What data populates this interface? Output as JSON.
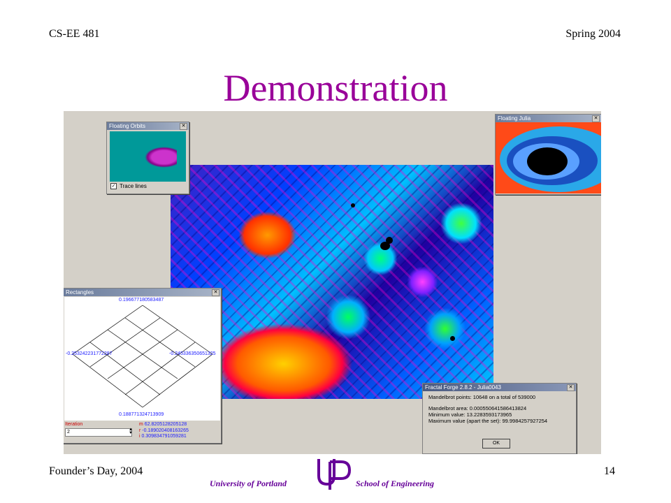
{
  "header": {
    "course": "CS-EE 481",
    "term": "Spring 2004"
  },
  "slide": {
    "title": "Demonstration"
  },
  "floating_orbits": {
    "title": "Floating Orbits",
    "trace_lines_label": "Trace lines",
    "trace_lines_checked": true
  },
  "floating_julia": {
    "title": "Floating Julia"
  },
  "rectangles": {
    "title": "Rectangles",
    "top": "0.196677180583487",
    "left": "-0.253242231772287",
    "right": "-0.245336350651325",
    "bottom": "0.188771324713909",
    "iteration_label": "Iteration",
    "iteration_value": "2",
    "m_label": "m",
    "m_value": "62.8205128205128",
    "r_label": "r",
    "r_value": "-0.189020408163265",
    "i_label": "i",
    "i_value": "0.309834791059281"
  },
  "fractal_forge": {
    "title": "Fractal Forge 2.8.2 - Julia0043",
    "line1": "Mandelbrot points: 10648 on a total of 539000",
    "line2": "Mandelbrot area: 0.000550641586413824",
    "line3": "Minimum value: 13.2283593173965",
    "line4": "Maximum value (apart the set): 99.9984257927254",
    "ok_label": "OK"
  },
  "footer": {
    "left": "Founder’s Day, 2004",
    "page_number": "14",
    "university": "University of Portland",
    "school": "School of Engineering"
  },
  "colors": {
    "title": "#990099",
    "logo": "#660099"
  }
}
